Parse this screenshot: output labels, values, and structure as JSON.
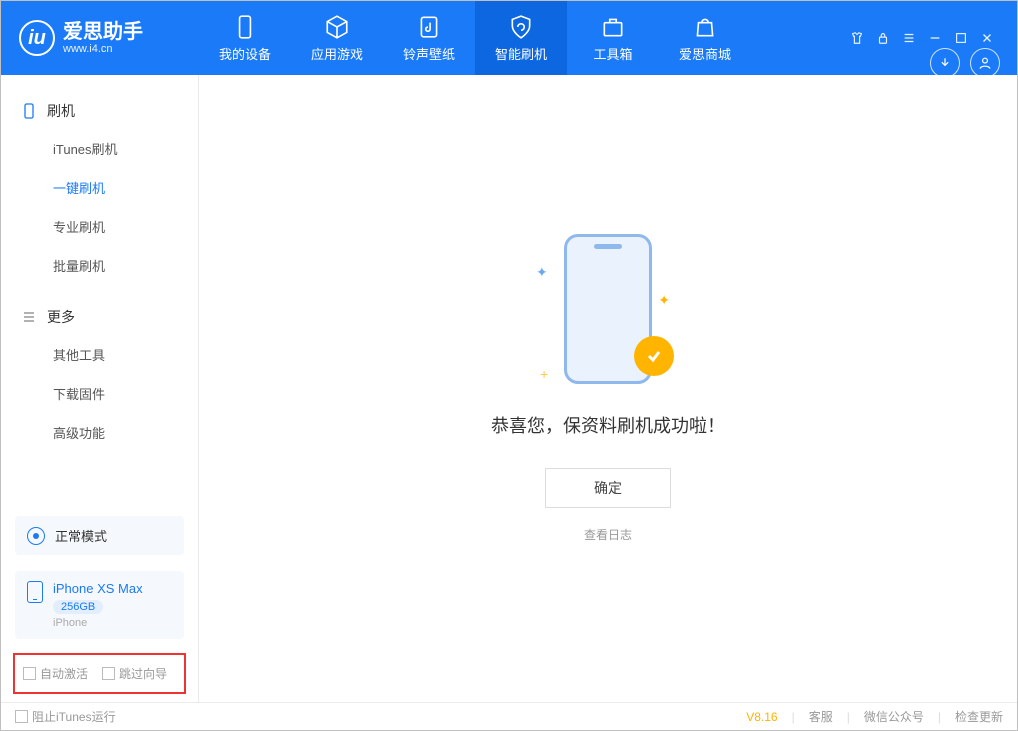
{
  "app": {
    "name": "爱思助手",
    "url": "www.i4.cn"
  },
  "nav": [
    {
      "label": "我的设备"
    },
    {
      "label": "应用游戏"
    },
    {
      "label": "铃声壁纸"
    },
    {
      "label": "智能刷机"
    },
    {
      "label": "工具箱"
    },
    {
      "label": "爱思商城"
    }
  ],
  "sidebar": {
    "group1": {
      "title": "刷机",
      "items": [
        "iTunes刷机",
        "一键刷机",
        "专业刷机",
        "批量刷机"
      ]
    },
    "group2": {
      "title": "更多",
      "items": [
        "其他工具",
        "下载固件",
        "高级功能"
      ]
    }
  },
  "mode": {
    "label": "正常模式"
  },
  "device": {
    "name": "iPhone XS Max",
    "capacity": "256GB",
    "type": "iPhone"
  },
  "options": {
    "auto_activate": "自动激活",
    "skip_guide": "跳过向导"
  },
  "main": {
    "success_text": "恭喜您，保资料刷机成功啦！",
    "ok": "确定",
    "view_log": "查看日志"
  },
  "footer": {
    "block_itunes": "阻止iTunes运行",
    "version": "V8.16",
    "support": "客服",
    "wechat": "微信公众号",
    "update": "检查更新"
  }
}
